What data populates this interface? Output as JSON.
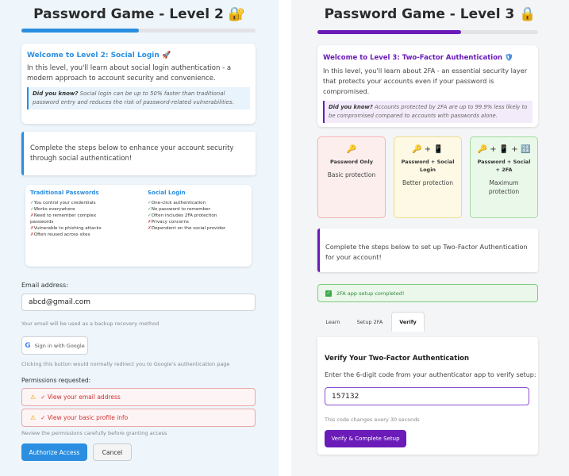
{
  "left": {
    "title": "Password Game - Level 2",
    "title_icon": "🔐",
    "progress": 0.5,
    "welcome": {
      "title": "Welcome to Level 2: Social Login",
      "title_icon": "🚀",
      "body": "In this level, you'll learn about social login authentication - a modern approach to account security and convenience.",
      "tip_label": "Did you know?",
      "tip_text": "Social login can be up to 50% faster than traditional password entry and reduces the risk of password-related vulnerabilities."
    },
    "instructions": "Complete the steps below to enhance your account security through social authentication!",
    "comparison": {
      "traditional": {
        "title": "Traditional Passwords",
        "items": [
          {
            "mark": "✓",
            "text": "You control your credentials"
          },
          {
            "mark": "✓",
            "text": "Works everywhere"
          },
          {
            "mark": "✗",
            "text": "Need to remember complex"
          },
          {
            "mark": "",
            "text": "passwords"
          },
          {
            "mark": "✗",
            "text": "Vulnerable to phishing attacks"
          },
          {
            "mark": "✗",
            "text": "Often reused across sites"
          }
        ]
      },
      "social": {
        "title": "Social Login",
        "items": [
          {
            "mark": "✓",
            "text": "One-click authentication"
          },
          {
            "mark": "✓",
            "text": "No password to remember"
          },
          {
            "mark": "✓",
            "text": "Often includes 2FA protection"
          },
          {
            "mark": "✗",
            "text": "Privacy concerns"
          },
          {
            "mark": "✗",
            "text": "Dependent on the social provider"
          }
        ]
      }
    },
    "email_label": "Email address:",
    "email_value": "abcd@gmail.com",
    "email_note": "Your email will be used as a backup recovery method",
    "google_button": "Sign in with Google",
    "google_note": "Clicking this button would normally redirect you to Google's authentication page",
    "permissions_label": "Permissions requested:",
    "permissions": [
      {
        "icon": "⚠",
        "text": "✓ View your email address"
      },
      {
        "icon": "⚠",
        "text": "✓ View your basic profile info"
      }
    ],
    "permissions_note": "Review the permissions carefully before granting access",
    "authorize_button": "Authorize Access",
    "cancel_button": "Cancel"
  },
  "right": {
    "title": "Password Game - Level 3",
    "title_icon": "🔒",
    "progress": 0.65,
    "welcome": {
      "title": "Welcome to Level 3: Two-Factor Authentication",
      "title_icon": "🛡",
      "body": "In this level, you'll learn about 2FA - an essential security layer that protects your accounts even if your password is compromised.",
      "tip_label": "Did you know?",
      "tip_text": "Accounts protected by 2FA are up to 99.9% less likely to be compromised compared to accounts with passwords alone."
    },
    "levels": [
      {
        "icons": "🔑",
        "title": "Password Only",
        "protection": "Basic protection"
      },
      {
        "icons": "🔑 + 📱",
        "title": "Password + Social Login",
        "protection": "Better protection"
      },
      {
        "icons": "🔑 + 📱 + 🔢",
        "title": "Password + Social + 2FA",
        "protection": "Maximum protection"
      }
    ],
    "instructions": "Complete the steps below to set up Two-Factor Authentication for your account!",
    "success": "2FA app setup completed!",
    "tabs": [
      "Learn",
      "Setup 2FA",
      "Verify"
    ],
    "verify": {
      "title": "Verify Your Two-Factor Authentication",
      "desc": "Enter the 6-digit code from your authenticator app to verify setup:",
      "code": "157132",
      "note": "This code changes every 30 seconds",
      "button": "Verify & Complete Setup"
    }
  },
  "colors": {
    "blue": "#2b8ee0",
    "purple": "#6a1bb8",
    "red": "#d13232"
  }
}
